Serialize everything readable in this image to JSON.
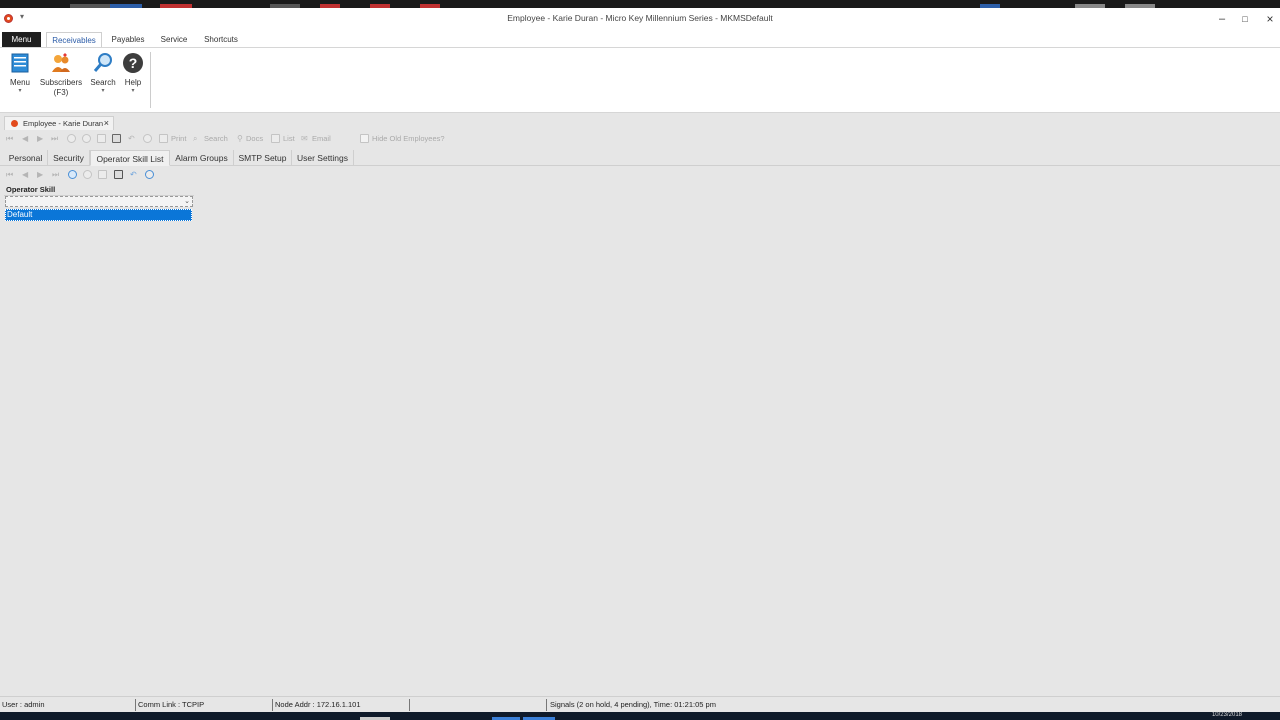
{
  "window": {
    "title": "Employee - Karie Duran - Micro Key Millennium Series - MKMSDefault",
    "min_glyph": "–",
    "max_glyph": "□",
    "close_glyph": "×"
  },
  "ribbon_tabs": {
    "menu": "Menu",
    "tabs": [
      "Receivables",
      "Payables",
      "Service",
      "Shortcuts"
    ]
  },
  "ribbon": {
    "buttons": [
      {
        "label": "Menu",
        "sub": "",
        "icon": "menu-book-icon"
      },
      {
        "label": "Subscribers",
        "sub": "(F3)",
        "icon": "subscribers-icon"
      },
      {
        "label": "Search",
        "sub": "",
        "icon": "magnifier-icon"
      },
      {
        "label": "Help",
        "sub": "",
        "icon": "help-icon"
      }
    ]
  },
  "doc_tab": {
    "label": "Employee - Karie Duran",
    "close": "×"
  },
  "toolbar": {
    "print": "Print",
    "search": "Search",
    "docs": "Docs",
    "list": "List",
    "email": "Email",
    "hide_old": "Hide Old Employees?"
  },
  "form_tabs": [
    "Personal",
    "Security",
    "Operator Skill List",
    "Alarm Groups",
    "SMTP Setup",
    "User Settings"
  ],
  "grid": {
    "header": "Operator Skill",
    "rows": [
      "Default"
    ]
  },
  "status": {
    "user": "User : admin",
    "comm": "Comm Link : TCPIP",
    "node": "Node Addr : 172.16.1.101",
    "signals": "Signals (2 on hold, 4 pending), Time: 01:21:05 pm"
  },
  "taskbar": {
    "clock": "10/23/2018"
  },
  "colors": {
    "accent": "#0b76d8",
    "menu_dark": "#1f1f1f",
    "app_icon": "#e24a1c"
  }
}
